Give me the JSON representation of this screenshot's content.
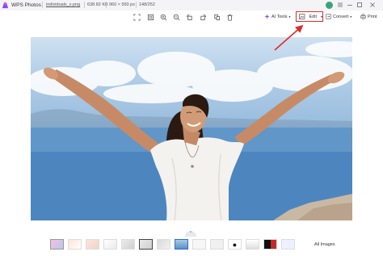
{
  "titlebar": {
    "app_name": "WPS Photos",
    "filename": "individuals_x.png",
    "filesize": "638.82 KB",
    "dimensions": "960 × 550 px",
    "counter": "148/252"
  },
  "toolbar": {
    "ai_tools_label": "AI Tools",
    "edit_label": "Edit",
    "convert_label": "Convert",
    "print_label": "Print"
  },
  "filmstrip": {
    "all_images_label": "All Images"
  },
  "colors": {
    "highlight": "#e02a2a",
    "accent": "#7a4cff",
    "avatar": "#3aa57a"
  }
}
